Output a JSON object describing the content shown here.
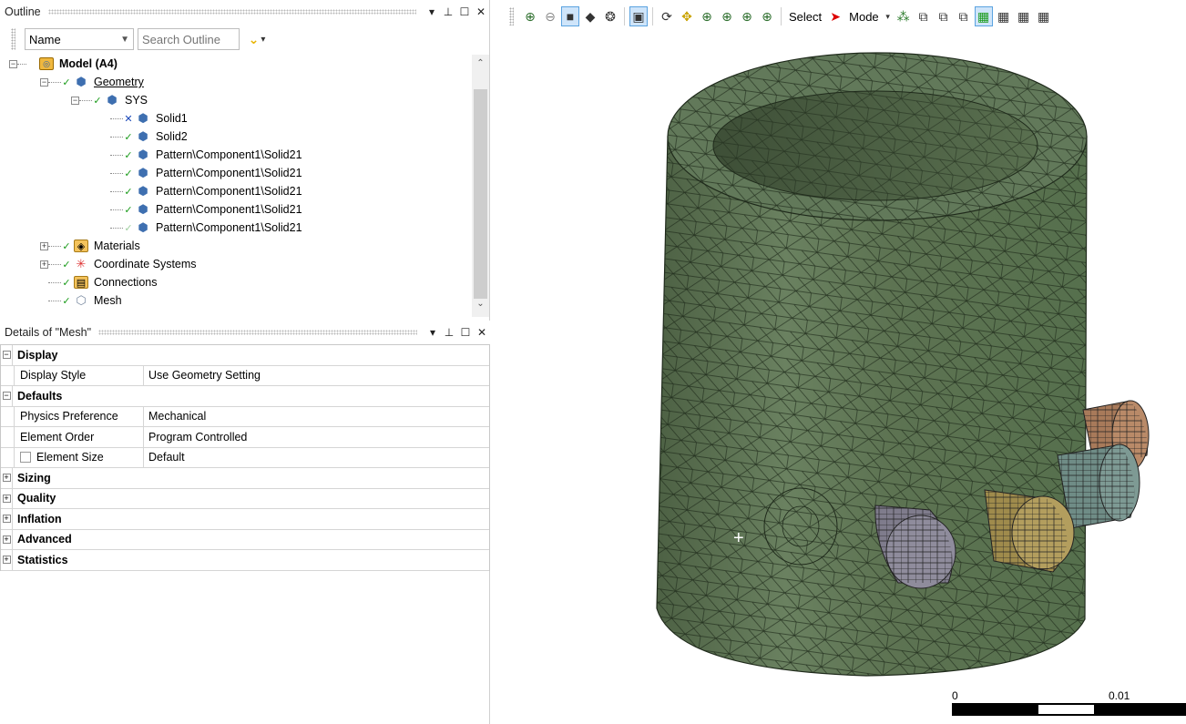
{
  "outline": {
    "title": "Outline",
    "controls": [
      "▾",
      "⊥",
      "☐",
      "✕"
    ],
    "filter_name": "Name",
    "search_placeholder": "Search Outline",
    "tree": [
      {
        "label": "Model (A4)",
        "status": "",
        "icon": "model-icon",
        "bold": true
      },
      {
        "label": "Geometry",
        "status": "ok",
        "icon": "geometry-icon",
        "underline": true
      },
      {
        "label": "SYS",
        "status": "ok-x",
        "icon": "part-icon"
      },
      {
        "label": "Solid1",
        "status": "bad",
        "icon": "solid-icon"
      },
      {
        "label": "Solid2",
        "status": "ok-x",
        "icon": "solid-icon"
      },
      {
        "label": "Pattern\\Component1\\Solid21",
        "status": "ok-x",
        "icon": "solid-icon"
      },
      {
        "label": "Pattern\\Component1\\Solid21",
        "status": "ok-x",
        "icon": "solid-icon"
      },
      {
        "label": "Pattern\\Component1\\Solid21",
        "status": "ok-x",
        "icon": "solid-icon"
      },
      {
        "label": "Pattern\\Component1\\Solid21",
        "status": "ok-x",
        "icon": "solid-icon"
      },
      {
        "label": "Pattern\\Component1\\Solid21",
        "status": "light",
        "icon": "solid-icon"
      },
      {
        "label": "Materials",
        "status": "ok",
        "icon": "materials-icon"
      },
      {
        "label": "Coordinate Systems",
        "status": "ok",
        "icon": "coordinate-systems-icon"
      },
      {
        "label": "Connections",
        "status": "ok",
        "icon": "connections-icon"
      },
      {
        "label": "Mesh",
        "status": "ok",
        "icon": "mesh-icon"
      }
    ]
  },
  "details": {
    "title": "Details of \"Mesh\"",
    "rows": [
      {
        "type": "group",
        "label": "Display",
        "expander": "−"
      },
      {
        "type": "prop",
        "key": "Display Style",
        "value": "Use Geometry Setting"
      },
      {
        "type": "group",
        "label": "Defaults",
        "expander": "−"
      },
      {
        "type": "prop",
        "key": "Physics Preference",
        "value": "Mechanical"
      },
      {
        "type": "prop",
        "key": "Element Order",
        "value": "Program Controlled"
      },
      {
        "type": "prop",
        "key": "Element Size",
        "value": "Default",
        "checkbox": true
      },
      {
        "type": "group",
        "label": "Sizing",
        "expander": "+"
      },
      {
        "type": "group",
        "label": "Quality",
        "expander": "+"
      },
      {
        "type": "group",
        "label": "Inflation",
        "expander": "+"
      },
      {
        "type": "group",
        "label": "Advanced",
        "expander": "+"
      },
      {
        "type": "group",
        "label": "Statistics",
        "expander": "+"
      }
    ]
  },
  "graphics_toolbar": {
    "select_label": "Select",
    "mode_label": "Mode"
  },
  "scale_bar": {
    "start": "0",
    "end": "0.01"
  },
  "colors": {
    "cylinder": "#5f7552",
    "pin_gray": "#7f7c8c",
    "pin_gold": "#9f8b4c",
    "pin_teal": "#6f8c86",
    "pin_copper": "#a87a5a"
  }
}
